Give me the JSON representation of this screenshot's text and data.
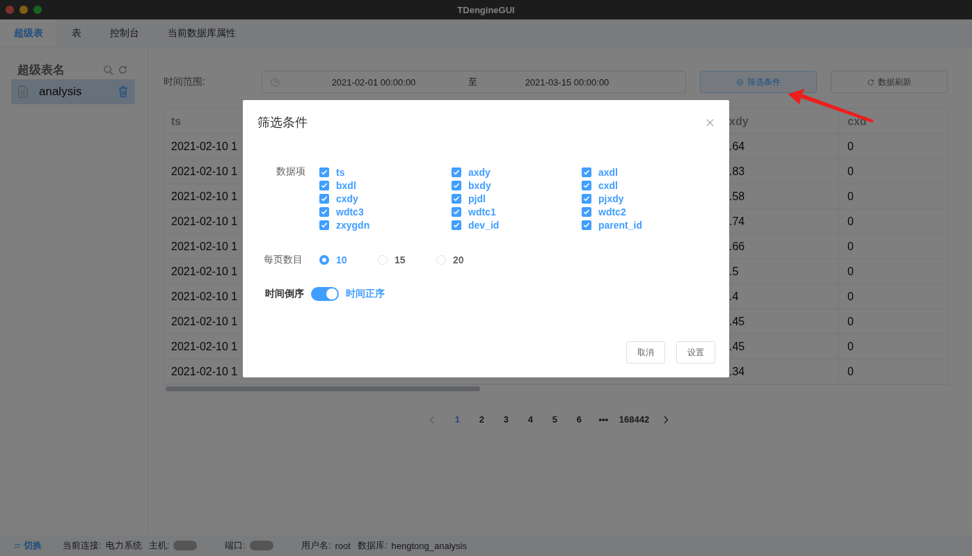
{
  "window": {
    "title": "TDengineGUI"
  },
  "tabs": [
    {
      "label": "超级表",
      "selected": true
    },
    {
      "label": "表",
      "selected": false
    },
    {
      "label": "控制台",
      "selected": false
    },
    {
      "label": "当前数据库属性",
      "selected": false
    }
  ],
  "sidebar": {
    "title": "超级表名",
    "items": [
      {
        "name": "analysis",
        "selected": true
      }
    ]
  },
  "time_range": {
    "label": "时间范围:",
    "start": "2021-02-01 00:00:00",
    "separator": "至",
    "end": "2021-03-15 00:00:00"
  },
  "toolbar_buttons": [
    {
      "kind": "filter",
      "label": "筛选条件",
      "active": true
    },
    {
      "kind": "refresh",
      "label": "数据刷新",
      "active": false
    }
  ],
  "table": {
    "columns": [
      "ts",
      "xdy",
      "cxd"
    ],
    "rows": [
      [
        "2021-02-10 1",
        ".64",
        "0"
      ],
      [
        "2021-02-10 1",
        ".83",
        "0"
      ],
      [
        "2021-02-10 1",
        ".58",
        "0"
      ],
      [
        "2021-02-10 1",
        ".74",
        "0"
      ],
      [
        "2021-02-10 1",
        ".66",
        "0"
      ],
      [
        "2021-02-10 1",
        ".5",
        "0"
      ],
      [
        "2021-02-10 1",
        ".4",
        "0"
      ],
      [
        "2021-02-10 1",
        ".45",
        "0"
      ],
      [
        "2021-02-10 1",
        ".45",
        "0"
      ],
      [
        "2021-02-10 1",
        ".34",
        "0"
      ]
    ]
  },
  "pagination": {
    "pages": [
      {
        "label": "1",
        "selected": true
      },
      {
        "label": "2",
        "selected": false
      },
      {
        "label": "3",
        "selected": false
      },
      {
        "label": "4",
        "selected": false
      },
      {
        "label": "5",
        "selected": false
      },
      {
        "label": "6",
        "selected": false
      }
    ],
    "ellipsis": "•••",
    "last": "168442"
  },
  "dialog": {
    "title": "筛选条件",
    "fields_label": "数据项",
    "fields": [
      {
        "label": "ts",
        "checked": true
      },
      {
        "label": "axdy",
        "checked": true
      },
      {
        "label": "axdl",
        "checked": true
      },
      {
        "label": "bxdl",
        "checked": true
      },
      {
        "label": "bxdy",
        "checked": true
      },
      {
        "label": "cxdl",
        "checked": true
      },
      {
        "label": "cxdy",
        "checked": true
      },
      {
        "label": "pjdl",
        "checked": true
      },
      {
        "label": "pjxdy",
        "checked": true
      },
      {
        "label": "wdtc3",
        "checked": true
      },
      {
        "label": "wdtc1",
        "checked": true
      },
      {
        "label": "wdtc2",
        "checked": true
      },
      {
        "label": "zxygdn",
        "checked": true
      },
      {
        "label": "dev_id",
        "checked": true
      },
      {
        "label": "parent_id",
        "checked": true
      }
    ],
    "page_size": {
      "label": "每页数目",
      "options": [
        {
          "label": "10",
          "selected": true
        },
        {
          "label": "15",
          "selected": false
        },
        {
          "label": "20",
          "selected": false
        }
      ]
    },
    "order": {
      "off_label": "时间倒序",
      "on_label": "时间正序",
      "on": true
    },
    "buttons": [
      "取消",
      "设置"
    ]
  },
  "status_bar": {
    "switch_label": "切换",
    "items": [
      {
        "label": "当前连接:",
        "value": "电力系统",
        "redacted": false
      },
      {
        "label": "主机:",
        "redacted": true
      },
      {
        "label": "端口:",
        "redacted": true
      },
      {
        "label": "用户名:",
        "value": "root",
        "redacted": false
      },
      {
        "label": "数据库:",
        "value": "hengtong_analysis",
        "redacted": false
      }
    ]
  }
}
